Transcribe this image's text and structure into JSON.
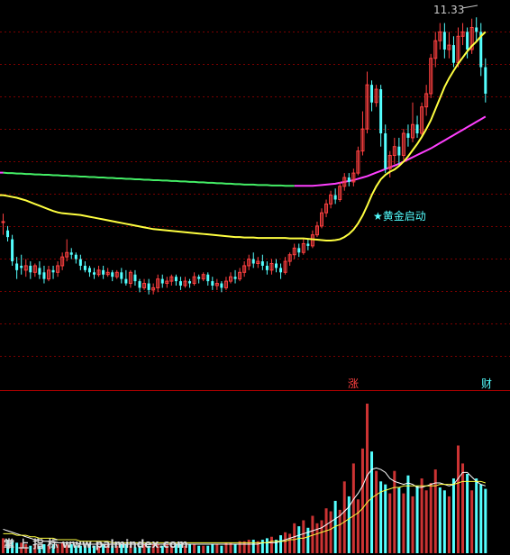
{
  "chart_data": [
    {
      "type": "candlestick",
      "title": "",
      "ylim": [
        3.8,
        11.6
      ],
      "grid": true,
      "annotations": {
        "high_label": "11.33",
        "signal_label": "★黄金启动"
      },
      "colors": {
        "up": "#ff4040",
        "down": "#54ffff",
        "ma_short": "#ffff40",
        "ma_long_early": "#44ee66",
        "ma_long_late": "#ff40ff",
        "grid": "#7a0000",
        "background": "#000000"
      },
      "candles": [
        [
          6.68,
          6.7,
          6.4,
          6.88
        ],
        [
          6.5,
          6.35,
          6.25,
          6.6
        ],
        [
          6.3,
          5.8,
          5.7,
          6.4
        ],
        [
          5.75,
          5.6,
          5.4,
          5.9
        ],
        [
          5.7,
          5.65,
          5.5,
          5.95
        ],
        [
          5.6,
          5.7,
          5.45,
          5.85
        ],
        [
          5.7,
          5.55,
          5.4,
          5.8
        ],
        [
          5.55,
          5.7,
          5.45,
          5.75
        ],
        [
          5.65,
          5.5,
          5.4,
          5.8
        ],
        [
          5.55,
          5.4,
          5.3,
          5.7
        ],
        [
          5.4,
          5.6,
          5.35,
          5.7
        ],
        [
          5.6,
          5.55,
          5.4,
          5.7
        ],
        [
          5.55,
          5.7,
          5.45,
          5.8
        ],
        [
          5.7,
          5.9,
          5.6,
          6.0
        ],
        [
          5.9,
          6.0,
          5.8,
          6.3
        ],
        [
          6.0,
          5.95,
          5.85,
          6.1
        ],
        [
          5.95,
          5.85,
          5.75,
          6.0
        ],
        [
          5.85,
          5.7,
          5.6,
          5.95
        ],
        [
          5.7,
          5.6,
          5.55,
          5.8
        ],
        [
          5.65,
          5.55,
          5.45,
          5.7
        ],
        [
          5.55,
          5.5,
          5.4,
          5.65
        ],
        [
          5.5,
          5.6,
          5.45,
          5.7
        ],
        [
          5.6,
          5.5,
          5.4,
          5.7
        ],
        [
          5.5,
          5.55,
          5.45,
          5.65
        ],
        [
          5.55,
          5.45,
          5.35,
          5.6
        ],
        [
          5.45,
          5.55,
          5.4,
          5.6
        ],
        [
          5.55,
          5.4,
          5.3,
          5.65
        ],
        [
          5.4,
          5.3,
          5.25,
          5.6
        ],
        [
          5.3,
          5.55,
          5.2,
          5.6
        ],
        [
          5.5,
          5.35,
          5.25,
          5.6
        ],
        [
          5.35,
          5.2,
          5.1,
          5.4
        ],
        [
          5.2,
          5.3,
          5.15,
          5.4
        ],
        [
          5.3,
          5.15,
          5.05,
          5.4
        ],
        [
          5.15,
          5.2,
          5.05,
          5.3
        ],
        [
          5.2,
          5.4,
          5.1,
          5.5
        ],
        [
          5.4,
          5.3,
          5.2,
          5.5
        ],
        [
          5.3,
          5.35,
          5.2,
          5.45
        ],
        [
          5.35,
          5.45,
          5.25,
          5.5
        ],
        [
          5.45,
          5.35,
          5.25,
          5.5
        ],
        [
          5.35,
          5.25,
          5.15,
          5.45
        ],
        [
          5.25,
          5.35,
          5.2,
          5.45
        ],
        [
          5.35,
          5.3,
          5.2,
          5.4
        ],
        [
          5.3,
          5.45,
          5.25,
          5.55
        ],
        [
          5.45,
          5.4,
          5.3,
          5.5
        ],
        [
          5.4,
          5.5,
          5.35,
          5.55
        ],
        [
          5.5,
          5.35,
          5.25,
          5.55
        ],
        [
          5.35,
          5.25,
          5.15,
          5.45
        ],
        [
          5.25,
          5.3,
          5.15,
          5.4
        ],
        [
          5.3,
          5.2,
          5.1,
          5.35
        ],
        [
          5.2,
          5.35,
          5.15,
          5.45
        ],
        [
          5.35,
          5.45,
          5.3,
          5.55
        ],
        [
          5.45,
          5.4,
          5.3,
          5.6
        ],
        [
          5.4,
          5.55,
          5.35,
          5.65
        ],
        [
          5.55,
          5.7,
          5.45,
          5.8
        ],
        [
          5.7,
          5.85,
          5.6,
          5.95
        ],
        [
          5.85,
          5.75,
          5.65,
          6.0
        ],
        [
          5.75,
          5.8,
          5.65,
          5.9
        ],
        [
          5.8,
          5.7,
          5.6,
          5.95
        ],
        [
          5.7,
          5.6,
          5.5,
          5.8
        ],
        [
          5.6,
          5.75,
          5.5,
          5.85
        ],
        [
          5.75,
          5.65,
          5.55,
          5.85
        ],
        [
          5.65,
          5.55,
          5.4,
          5.75
        ],
        [
          5.55,
          5.8,
          5.5,
          5.9
        ],
        [
          5.8,
          5.95,
          5.7,
          6.0
        ],
        [
          5.95,
          6.1,
          5.85,
          6.2
        ],
        [
          6.1,
          6.0,
          5.9,
          6.2
        ],
        [
          6.0,
          6.2,
          5.95,
          6.3
        ],
        [
          6.2,
          6.15,
          6.05,
          6.3
        ],
        [
          6.15,
          6.4,
          6.1,
          6.5
        ],
        [
          6.4,
          6.6,
          6.35,
          6.7
        ],
        [
          6.6,
          6.9,
          6.55,
          7.0
        ],
        [
          6.9,
          7.1,
          6.8,
          7.2
        ],
        [
          7.1,
          7.3,
          7.0,
          7.4
        ],
        [
          7.3,
          7.2,
          7.1,
          7.45
        ],
        [
          7.2,
          7.5,
          7.15,
          7.6
        ],
        [
          7.5,
          7.7,
          7.4,
          7.8
        ],
        [
          7.7,
          7.6,
          7.5,
          7.8
        ],
        [
          7.6,
          7.8,
          7.5,
          7.9
        ],
        [
          7.8,
          8.3,
          7.75,
          8.4
        ],
        [
          8.3,
          8.8,
          8.2,
          9.2
        ],
        [
          8.8,
          9.8,
          8.7,
          10.1
        ],
        [
          9.8,
          9.4,
          9.2,
          9.9
        ],
        [
          9.4,
          9.7,
          9.3,
          9.8
        ],
        [
          9.7,
          8.7,
          8.4,
          9.8
        ],
        [
          8.7,
          7.9,
          7.8,
          8.9
        ],
        [
          7.9,
          8.2,
          7.7,
          8.3
        ],
        [
          8.2,
          8.4,
          8.0,
          8.6
        ],
        [
          8.4,
          8.2,
          8.0,
          8.6
        ],
        [
          8.2,
          8.7,
          8.1,
          8.8
        ],
        [
          8.7,
          8.6,
          8.4,
          8.9
        ],
        [
          8.6,
          8.9,
          8.5,
          9.4
        ],
        [
          8.9,
          8.7,
          8.6,
          9.1
        ],
        [
          8.7,
          9.3,
          8.6,
          9.4
        ],
        [
          9.3,
          9.6,
          9.1,
          9.8
        ],
        [
          9.6,
          10.4,
          9.5,
          10.5
        ],
        [
          10.4,
          10.8,
          10.2,
          11.0
        ],
        [
          10.8,
          11.0,
          10.6,
          11.2
        ],
        [
          11.0,
          10.6,
          10.4,
          11.2
        ],
        [
          10.6,
          10.7,
          10.4,
          11.0
        ],
        [
          10.7,
          10.3,
          10.2,
          10.9
        ],
        [
          10.3,
          10.9,
          10.2,
          11.1
        ],
        [
          10.9,
          11.0,
          10.7,
          11.2
        ],
        [
          11.0,
          10.6,
          10.4,
          11.1
        ],
        [
          10.6,
          11.1,
          10.5,
          11.3
        ],
        [
          11.1,
          11.0,
          10.8,
          11.33
        ],
        [
          11.0,
          10.2,
          10.0,
          11.2
        ],
        [
          10.2,
          9.6,
          9.4,
          10.4
        ]
      ],
      "ma_short": [
        7.3,
        7.28,
        7.26,
        7.24,
        7.21,
        7.18,
        7.14,
        7.1,
        7.06,
        7.02,
        6.98,
        6.94,
        6.91,
        6.89,
        6.88,
        6.87,
        6.86,
        6.85,
        6.83,
        6.81,
        6.79,
        6.77,
        6.75,
        6.73,
        6.71,
        6.69,
        6.67,
        6.65,
        6.63,
        6.61,
        6.59,
        6.57,
        6.55,
        6.53,
        6.52,
        6.51,
        6.5,
        6.49,
        6.48,
        6.47,
        6.46,
        6.45,
        6.44,
        6.43,
        6.42,
        6.41,
        6.4,
        6.39,
        6.38,
        6.37,
        6.36,
        6.35,
        6.35,
        6.34,
        6.34,
        6.34,
        6.33,
        6.33,
        6.33,
        6.33,
        6.33,
        6.33,
        6.33,
        6.32,
        6.32,
        6.32,
        6.32,
        6.31,
        6.3,
        6.29,
        6.28,
        6.27,
        6.27,
        6.28,
        6.3,
        6.35,
        6.42,
        6.52,
        6.66,
        6.84,
        7.06,
        7.3,
        7.5,
        7.66,
        7.76,
        7.83,
        7.88,
        7.96,
        8.06,
        8.18,
        8.32,
        8.46,
        8.62,
        8.8,
        9.0,
        9.25,
        9.5,
        9.75,
        9.95,
        10.12,
        10.28,
        10.42,
        10.56,
        10.68,
        10.78,
        10.9,
        11.0
      ],
      "ma_long_start_index": 0,
      "ma_long_color_switch_index": 64,
      "ma_long": [
        7.81,
        7.8,
        7.8,
        7.79,
        7.79,
        7.78,
        7.78,
        7.77,
        7.77,
        7.76,
        7.76,
        7.75,
        7.75,
        7.74,
        7.74,
        7.73,
        7.73,
        7.72,
        7.72,
        7.71,
        7.71,
        7.7,
        7.7,
        7.69,
        7.69,
        7.68,
        7.68,
        7.67,
        7.67,
        7.66,
        7.66,
        7.65,
        7.65,
        7.64,
        7.64,
        7.63,
        7.63,
        7.62,
        7.62,
        7.61,
        7.61,
        7.6,
        7.6,
        7.59,
        7.59,
        7.58,
        7.58,
        7.57,
        7.57,
        7.56,
        7.56,
        7.55,
        7.55,
        7.54,
        7.54,
        7.54,
        7.53,
        7.53,
        7.53,
        7.52,
        7.52,
        7.52,
        7.51,
        7.51,
        7.51,
        7.51,
        7.51,
        7.51,
        7.51,
        7.52,
        7.53,
        7.54,
        7.55,
        7.56,
        7.58,
        7.6,
        7.62,
        7.64,
        7.67,
        7.7,
        7.73,
        7.77,
        7.81,
        7.85,
        7.89,
        7.93,
        7.97,
        8.01,
        8.06,
        8.11,
        8.16,
        8.21,
        8.26,
        8.31,
        8.36,
        8.42,
        8.48,
        8.54,
        8.6,
        8.66,
        8.72,
        8.78,
        8.84,
        8.9,
        8.96,
        9.02,
        9.08
      ]
    },
    {
      "type": "bar",
      "title": "",
      "ylim": [
        0,
        100
      ],
      "volume": [
        10,
        9,
        8,
        7,
        7,
        6,
        5,
        6,
        5,
        6,
        5,
        6,
        6,
        7,
        6,
        6,
        5,
        5,
        5,
        6,
        5,
        5,
        6,
        6,
        5,
        5,
        6,
        6,
        5,
        4,
        5,
        6,
        5,
        6,
        6,
        5,
        6,
        5,
        6,
        6,
        5,
        6,
        6,
        5,
        5,
        5,
        6,
        6,
        5,
        7,
        7,
        6,
        8,
        8,
        9,
        9,
        8,
        9,
        10,
        11,
        9,
        12,
        14,
        13,
        20,
        18,
        22,
        17,
        25,
        20,
        22,
        30,
        28,
        35,
        29,
        48,
        38,
        60,
        36,
        70,
        100,
        68,
        55,
        48,
        46,
        40,
        55,
        44,
        40,
        52,
        38,
        45,
        50,
        42,
        47,
        56,
        44,
        42,
        38,
        50,
        72,
        60,
        53,
        42,
        50,
        46,
        43
      ],
      "volume_up": [
        1,
        0,
        0,
        0,
        1,
        1,
        0,
        1,
        0,
        0,
        1,
        0,
        1,
        1,
        1,
        0,
        0,
        0,
        0,
        0,
        0,
        1,
        0,
        1,
        0,
        1,
        0,
        0,
        1,
        0,
        0,
        1,
        0,
        1,
        1,
        0,
        1,
        1,
        0,
        0,
        1,
        0,
        1,
        0,
        1,
        0,
        0,
        1,
        0,
        1,
        1,
        0,
        1,
        1,
        1,
        0,
        1,
        0,
        0,
        1,
        0,
        0,
        1,
        1,
        1,
        0,
        1,
        0,
        1,
        1,
        1,
        1,
        1,
        0,
        1,
        1,
        0,
        1,
        1,
        1,
        1,
        0,
        1,
        0,
        0,
        1,
        1,
        0,
        1,
        0,
        1,
        0,
        1,
        1,
        1,
        1,
        0,
        0,
        1,
        0,
        1,
        1,
        0,
        1,
        0,
        0,
        0
      ],
      "line_a": [
        16,
        15,
        14,
        13,
        12,
        11,
        10,
        9,
        9,
        8,
        8,
        8,
        7,
        7,
        7,
        7,
        7,
        6,
        6,
        6,
        6,
        6,
        6,
        6,
        6,
        6,
        6,
        6,
        6,
        6,
        6,
        6,
        6,
        6,
        6,
        6,
        6,
        6,
        6,
        6,
        6,
        6,
        6,
        6,
        6,
        6,
        6,
        6,
        6,
        6,
        6,
        6,
        6,
        6,
        6,
        6,
        6,
        7,
        7,
        7,
        7,
        8,
        9,
        10,
        11,
        12,
        13,
        14,
        15,
        16,
        17,
        19,
        21,
        23,
        25,
        28,
        31,
        36,
        40,
        45,
        52,
        56,
        57,
        56,
        54,
        50,
        48,
        47,
        46,
        47,
        46,
        44,
        44,
        45,
        46,
        47,
        47,
        46,
        45,
        46,
        50,
        54,
        54,
        51,
        48,
        46,
        45
      ],
      "line_b": [
        13,
        13,
        13,
        12,
        12,
        12,
        11,
        11,
        10,
        10,
        10,
        10,
        9,
        9,
        9,
        9,
        9,
        8,
        8,
        8,
        8,
        8,
        8,
        8,
        7,
        7,
        7,
        7,
        7,
        7,
        7,
        7,
        7,
        7,
        7,
        7,
        7,
        7,
        7,
        7,
        7,
        7,
        7,
        7,
        7,
        7,
        7,
        7,
        7,
        7,
        7,
        7,
        7,
        7,
        7,
        7,
        7,
        7,
        7,
        8,
        8,
        8,
        8,
        9,
        9,
        10,
        10,
        11,
        12,
        13,
        14,
        15,
        16,
        18,
        19,
        21,
        23,
        25,
        27,
        30,
        34,
        37,
        39,
        41,
        42,
        43,
        44,
        44,
        45,
        45,
        45,
        45,
        45,
        45,
        45,
        45,
        46,
        46,
        46,
        46,
        47,
        48,
        48,
        48,
        48,
        48,
        47
      ],
      "markers": {
        "left": "涨",
        "right": "财"
      },
      "watermark": "掌 上 指 标  www.palmindex.com"
    }
  ]
}
